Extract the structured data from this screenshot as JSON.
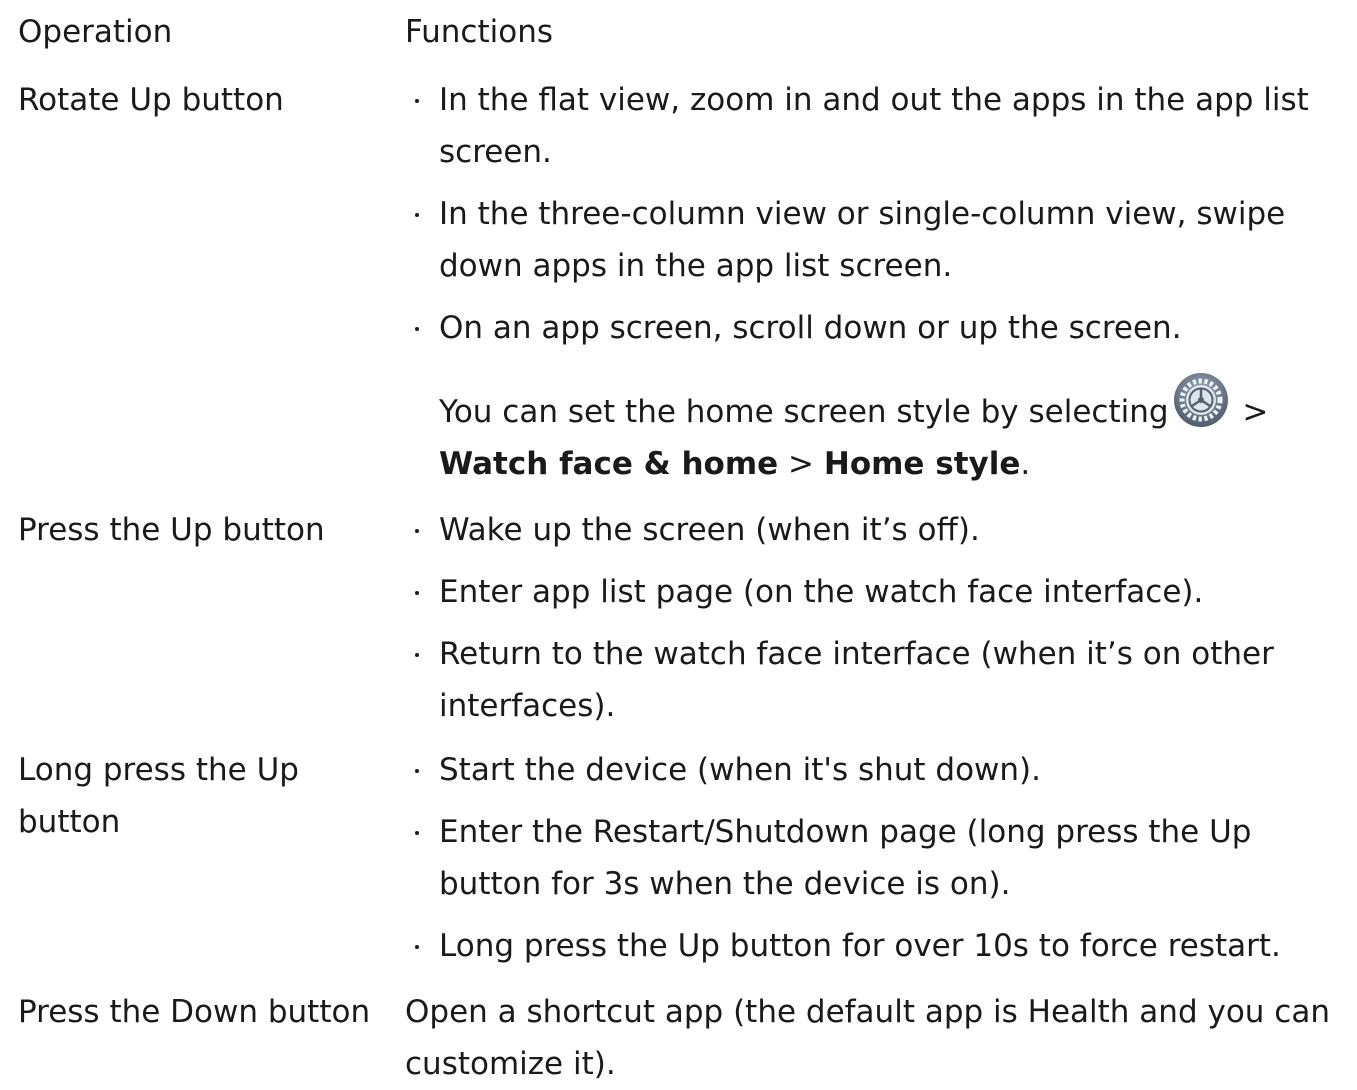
{
  "table": {
    "header": {
      "operation": "Operation",
      "functions": "Functions"
    },
    "rows": [
      {
        "operation": "Rotate Up button",
        "bullets": [
          "In the flat view, zoom in and out the apps in the app list screen.",
          "In the three-column view or single-column view, swipe down apps in the app list screen.",
          "On an app screen, scroll down or up the screen."
        ],
        "note": {
          "prefix": "You can set the home screen style by selecting",
          "icon": "settings-gear-icon",
          "sep1": " > ",
          "bold1": "Watch face & home",
          "sep2": " > ",
          "bold2": "Home style",
          "suffix": "."
        }
      },
      {
        "operation": "Press the Up button",
        "bullets": [
          "Wake up the screen (when it’s off).",
          "Enter app list page (on the watch face interface).",
          "Return to the watch face interface (when it’s on other interfaces)."
        ]
      },
      {
        "operation": "Long press the Up button",
        "bullets": [
          "Start the device (when it's shut down).",
          "Enter the Restart/Shutdown page (long press the Up button for 3s when the device is on).",
          "Long press the Up button for over 10s to force restart."
        ]
      },
      {
        "operation": "Press the Down button",
        "text": "Open a shortcut app (the default app is Health and you can customize it)."
      }
    ]
  }
}
